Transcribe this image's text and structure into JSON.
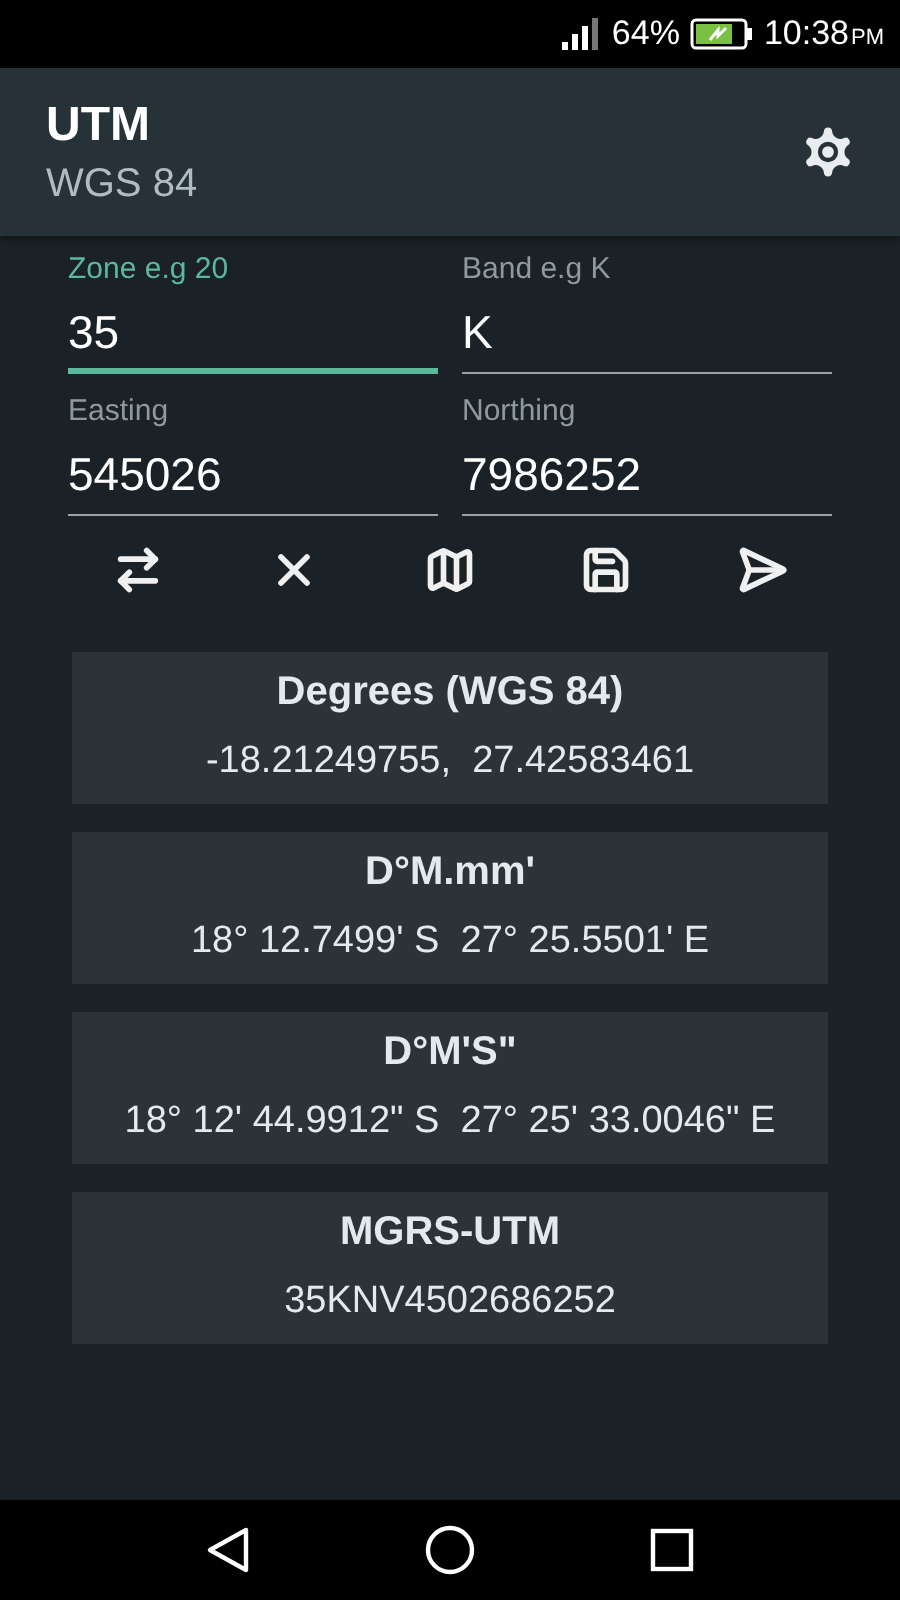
{
  "status_bar": {
    "battery_percent": "64%",
    "time": "10:38",
    "meridiem": "PM"
  },
  "app_bar": {
    "title": "UTM",
    "subtitle": "WGS 84"
  },
  "fields": [
    {
      "label": "Zone e.g 20",
      "value": "35",
      "focused": true
    },
    {
      "label": "Band e.g K",
      "value": "K",
      "focused": false
    },
    {
      "label": "Easting",
      "value": "545026",
      "focused": false
    },
    {
      "label": "Northing",
      "value": "7986252",
      "focused": false
    }
  ],
  "toolbar": [
    {
      "kind": "swap"
    },
    {
      "kind": "clear"
    },
    {
      "kind": "map"
    },
    {
      "kind": "save"
    },
    {
      "kind": "send"
    }
  ],
  "results": [
    {
      "title": "Degrees (WGS 84)",
      "value": "-18.21249755,  27.42583461"
    },
    {
      "title": "D°M.mm'",
      "value": "18° 12.7499' S  27° 25.5501' E"
    },
    {
      "title": "D°M'S\"",
      "value": "18° 12' 44.9912\" S  27° 25' 33.0046\" E"
    },
    {
      "title": "MGRS-UTM",
      "value": "35KNV4502686252"
    }
  ]
}
